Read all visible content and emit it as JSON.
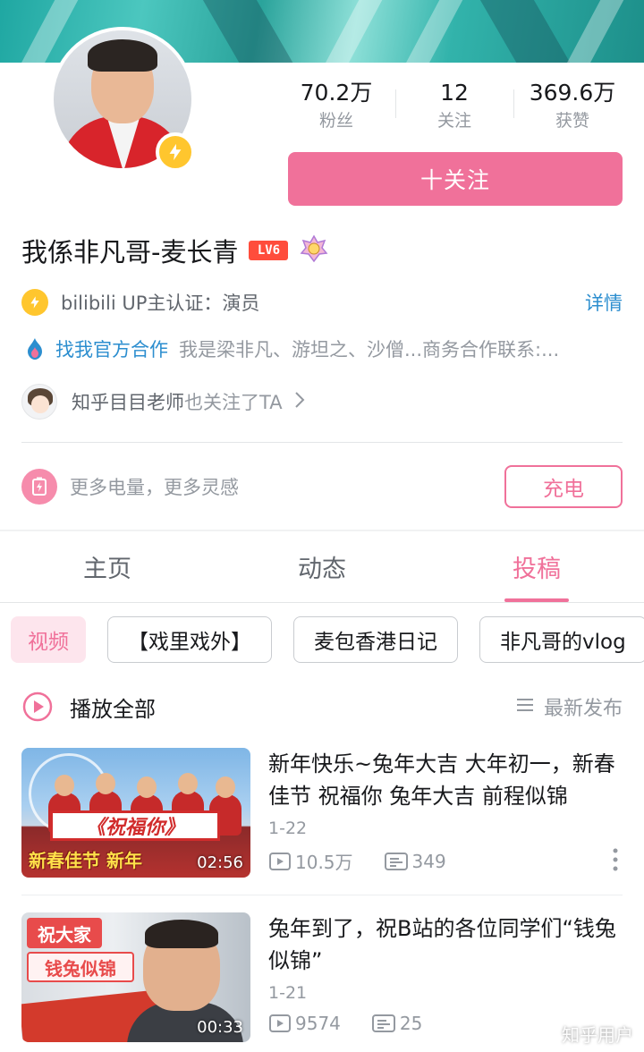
{
  "profile": {
    "stats": [
      {
        "value": "70.2万",
        "label": "粉丝"
      },
      {
        "value": "12",
        "label": "关注"
      },
      {
        "value": "369.6万",
        "label": "获赞"
      }
    ],
    "follow_label": "十关注",
    "name": "我係非凡哥-麦长青",
    "level": "LV6",
    "verify_text": "bilibili UP主认证：演员",
    "detail_label": "详情",
    "coop_link": "找我官方合作",
    "coop_desc": "我是梁非凡、游坦之、沙僧...商务合作联系:...",
    "fan_name": "知乎目目老师",
    "fan_suffix": "也关注了TA",
    "charge_text": "更多电量，更多灵感",
    "charge_label": "充电"
  },
  "tabs": [
    {
      "label": "主页"
    },
    {
      "label": "动态"
    },
    {
      "label": "投稿",
      "active": true
    }
  ],
  "chips": [
    {
      "label": "视频",
      "active": true
    },
    {
      "label": "【戏里戏外】"
    },
    {
      "label": "麦包香港日记"
    },
    {
      "label": "非凡哥的vlog"
    }
  ],
  "list_header": {
    "play_all": "播放全部",
    "sort": "最新发布"
  },
  "videos": [
    {
      "title": "新年快乐~兔年大吉 大年初一，新春佳节 祝福你 兔年大吉 前程似锦",
      "date": "1-22",
      "views": "10.5万",
      "comments": "349",
      "duration": "02:56",
      "thumb_title": "《祝福你》",
      "thumb_caption": "新春佳节 新年"
    },
    {
      "title": "兔年到了，祝B站的各位同学们“钱兔似锦”",
      "date": "1-21",
      "views": "9574",
      "comments": "25",
      "duration": "00:33",
      "thumb_caption": "祝大家",
      "thumb_caption2": "钱兔似锦"
    }
  ],
  "watermark": "知乎用户",
  "colors": {
    "accent_pink": "#f0719a",
    "link_blue": "#2c8ecf",
    "banner_teal": "#2aa39b",
    "badge_yellow": "#ffc62e"
  }
}
